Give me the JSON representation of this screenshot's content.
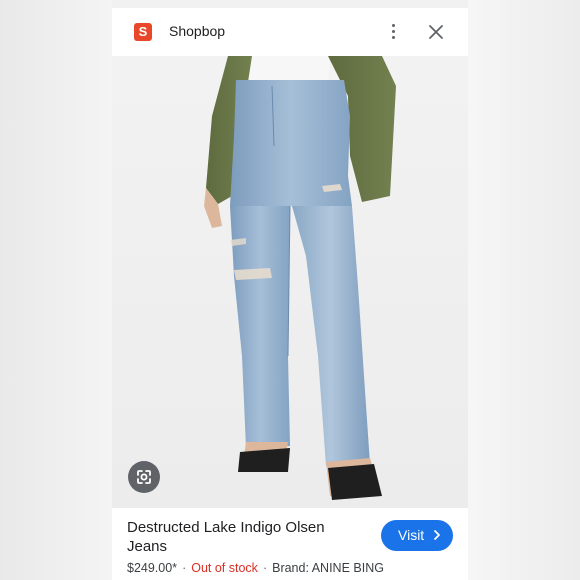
{
  "header": {
    "favicon_letter": "S",
    "site_name": "Shopbop",
    "menu_icon": "more-vert-icon",
    "close_icon": "close-icon"
  },
  "image": {
    "alt": "Model wearing light wash distressed straight-leg jeans with white top, olive jacket and black sandals",
    "lens_icon": "google-lens-icon"
  },
  "product": {
    "title": "Destructed Lake Indigo Olsen Jeans",
    "price": "$249.00*",
    "stock_status": "Out of stock",
    "brand": "Brand: ANINE BING",
    "separator": "·"
  },
  "actions": {
    "visit_label": "Visit",
    "visit_icon": "chevron-right-icon"
  },
  "colors": {
    "favicon_bg": "#e8472a",
    "visit_bg": "#1a73e8",
    "out_of_stock": "#d93025"
  }
}
